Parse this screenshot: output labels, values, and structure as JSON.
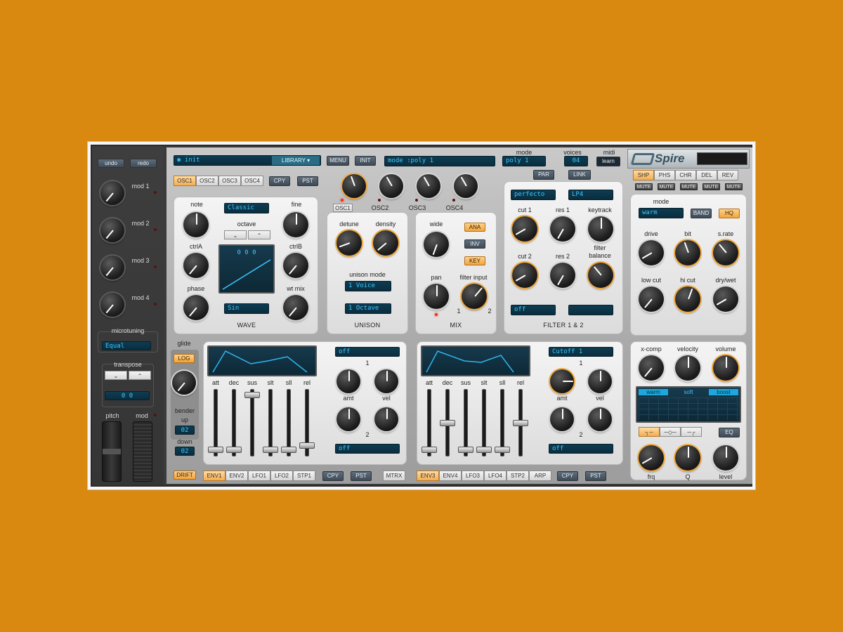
{
  "side": {
    "undo": "undo",
    "redo": "redo",
    "mods": [
      "mod 1",
      "mod 2",
      "mod 3",
      "mod 4"
    ],
    "microtuning": "microtuning",
    "microtuning_value": "Equal",
    "transpose": "transpose",
    "transpose_value": "0      0",
    "pitch": "pitch",
    "mod": "mod"
  },
  "top": {
    "preset": "◉ init",
    "library": "LIBRARY ▾",
    "menu": "MENU",
    "init": "INIT",
    "mode_display": "mode          :poly 1",
    "mode_label": "mode",
    "mode_value": "poly 1",
    "voices_label": "voices",
    "voices_value": "04",
    "midi_label": "midi",
    "learn": "learn",
    "brand": "Spire"
  },
  "osc_tabs": [
    "OSC1",
    "OSC2",
    "OSC3",
    "OSC4"
  ],
  "cpy": "CPY",
  "pst": "PST",
  "osc_knobs": [
    "OSC1",
    "OSC2",
    "OSC3",
    "OSC4"
  ],
  "wave": {
    "note": "note",
    "fine": "fine",
    "mode": "Classic",
    "octave": "octave",
    "ctrlA": "ctrlA",
    "ctrlB": "ctrlB",
    "phase": "phase",
    "wtmix": "wt mix",
    "screen_vals": "0    0    0",
    "wave_type": "Sin",
    "title": "WAVE"
  },
  "unison": {
    "detune": "detune",
    "density": "density",
    "mode_label": "unison mode",
    "voice": "1 Voice",
    "octave": "1 Octave",
    "title": "UNISON"
  },
  "mix": {
    "wide": "wide",
    "ana": "ANA",
    "inv": "INV",
    "key": "KEY",
    "pan": "pan",
    "filter_input": "filter input",
    "one": "1",
    "two": "2",
    "title": "MIX"
  },
  "filter": {
    "par": "PAR",
    "link": "LINK",
    "type1": "perfecto",
    "type2": "LP4",
    "cut1": "cut 1",
    "res1": "res 1",
    "keytrack": "keytrack",
    "cut2": "cut 2",
    "res2": "res 2",
    "balance": "filter\nbalance",
    "off": "off",
    "title": "FILTER 1 & 2"
  },
  "fx": {
    "tabs": [
      "SHP",
      "PHS",
      "CHR",
      "DEL",
      "REV"
    ],
    "mute": "MUTE",
    "mode": "mode",
    "mode_value": "warm",
    "band": "BAND",
    "hq": "HQ",
    "drive": "drive",
    "bit": "bit",
    "srate": "s.rate",
    "lowcut": "low cut",
    "hicut": "hi cut",
    "drywet": "dry/wet"
  },
  "eq": {
    "xcomp": "x-comp",
    "velocity": "velocity",
    "volume": "volume",
    "warm": "warm",
    "soft": "soft",
    "boost": "boost",
    "eq": "EQ",
    "frq": "frq",
    "q": "Q",
    "level": "level"
  },
  "glide": {
    "glide": "glide",
    "log": "LOG",
    "bender": "bender",
    "up": "up",
    "up_val": "02",
    "down": "down",
    "down_val": "02"
  },
  "env": {
    "labels": [
      "att",
      "dec",
      "sus",
      "slt",
      "sll",
      "rel"
    ],
    "target1": "off",
    "target2": "off",
    "amt": "amt",
    "vel": "vel",
    "one": "1",
    "two": "2"
  },
  "env2": {
    "target1": "Cutoff 1",
    "target2": "off"
  },
  "bottom_tabs1": [
    "ENV1",
    "ENV2",
    "LFO1",
    "LFO2",
    "STP1"
  ],
  "bottom_tabs2": [
    "ENV3",
    "ENV4",
    "LFO3",
    "LFO4",
    "STP2",
    "ARP"
  ],
  "drift": "DRIFT",
  "mtrx": "MTRX"
}
